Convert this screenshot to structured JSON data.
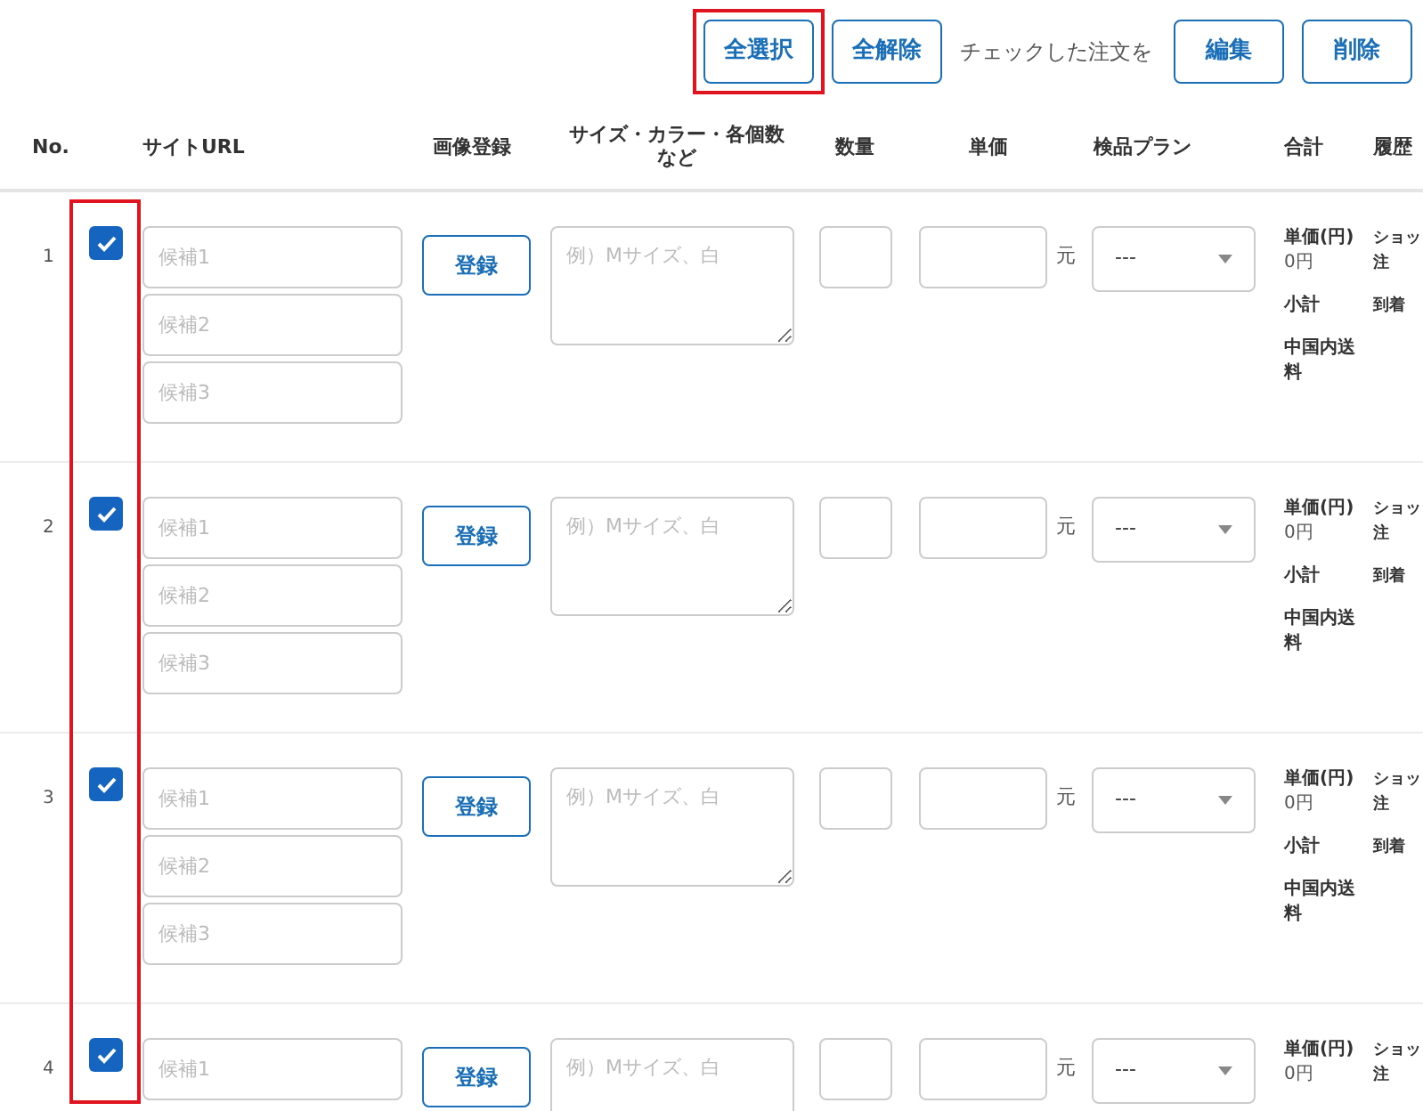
{
  "toolbar": {
    "buttons": [
      {
        "label": "全選択",
        "highlighted": true
      },
      {
        "label": "全解除",
        "highlighted": false
      }
    ],
    "note": "チェックした注文を",
    "actions": [
      {
        "label": "編集"
      },
      {
        "label": "削除"
      }
    ]
  },
  "checkbox_column_highlighted": true,
  "columns": [
    "No.",
    "サイトURL",
    "画像登録",
    "サイズ・カラー・各個数など",
    "数量",
    "単価",
    "検品プラン",
    "合計",
    "履歴"
  ],
  "rows": [
    {
      "no": "1",
      "checked": true,
      "candidates": [
        {
          "placeholder": "候補1"
        },
        {
          "placeholder": "候補2"
        },
        {
          "placeholder": "候補3"
        }
      ],
      "register": "登録",
      "notes_placeholder": "例）Mサイズ、白",
      "currency": "元",
      "plan": "---",
      "totals": [
        "単価(円)",
        "0円",
        "小計",
        "中国内送料"
      ],
      "history": [
        "ショッ注",
        "到着"
      ]
    },
    {
      "no": "2",
      "checked": true,
      "candidates": [
        {
          "placeholder": "候補1"
        },
        {
          "placeholder": "候補2"
        },
        {
          "placeholder": "候補3"
        }
      ],
      "register": "登録",
      "notes_placeholder": "例）Mサイズ、白",
      "currency": "元",
      "plan": "---",
      "totals": [
        "単価(円)",
        "0円",
        "小計",
        "中国内送料"
      ],
      "history": [
        "ショッ注",
        "到着"
      ]
    },
    {
      "no": "3",
      "checked": true,
      "candidates": [
        {
          "placeholder": "候補1"
        },
        {
          "placeholder": "候補2"
        },
        {
          "placeholder": "候補3"
        }
      ],
      "register": "登録",
      "notes_placeholder": "例）Mサイズ、白",
      "currency": "元",
      "plan": "---",
      "totals": [
        "単価(円)",
        "0円",
        "小計",
        "中国内送料"
      ],
      "history": [
        "ショッ注",
        "到着"
      ]
    },
    {
      "no": "4",
      "checked": true,
      "candidates": [
        {
          "placeholder": "候補1"
        }
      ],
      "register": "登録",
      "notes_placeholder": "例）Mサイズ、白",
      "currency": "元",
      "plan": "---",
      "totals": [
        "単価(円)",
        "0円"
      ],
      "history": [
        "ショッ注"
      ]
    }
  ]
}
